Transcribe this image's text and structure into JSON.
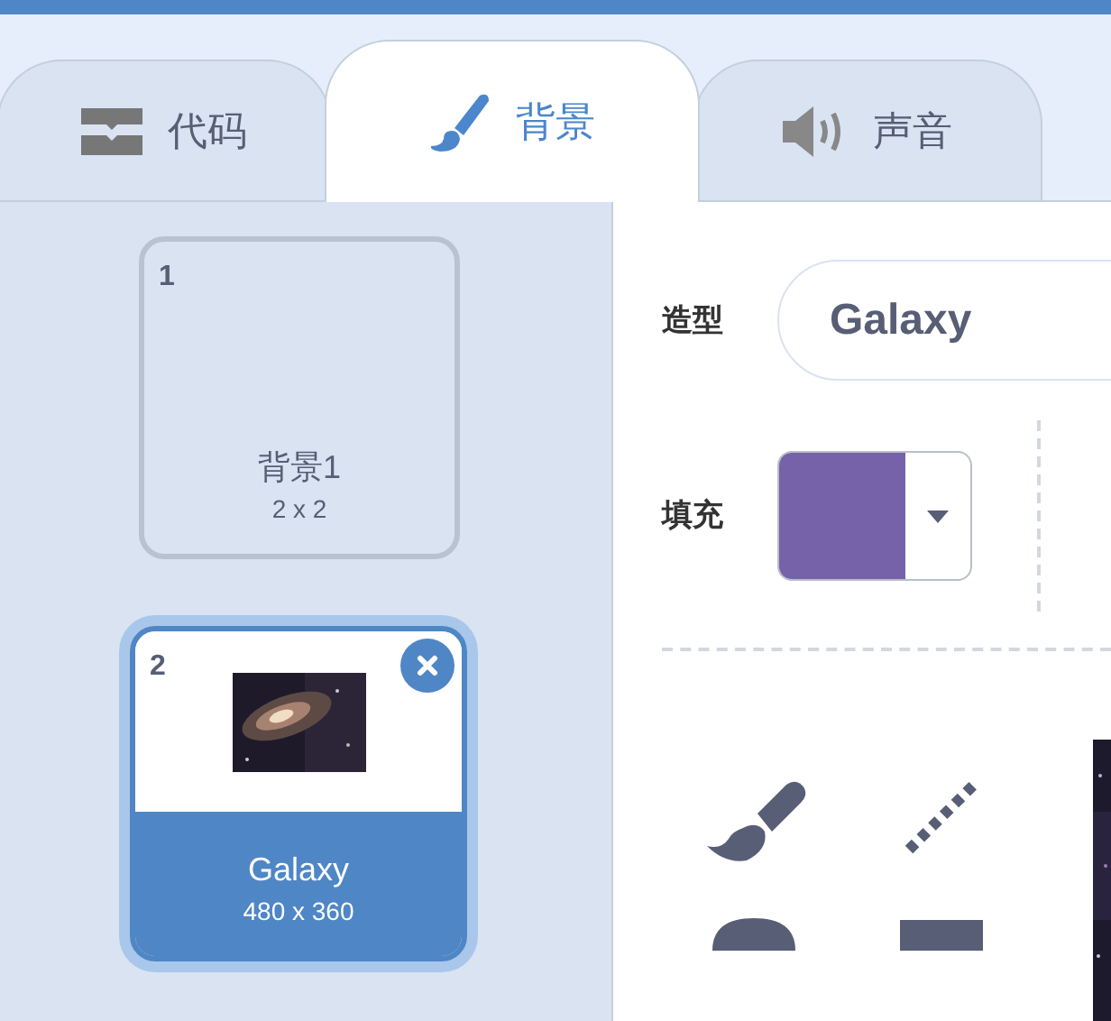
{
  "tabs": [
    {
      "label": "代码",
      "kind": "code",
      "selected": false
    },
    {
      "label": "背景",
      "kind": "backdrop",
      "selected": true
    },
    {
      "label": "声音",
      "kind": "sound",
      "selected": false
    }
  ],
  "backdrops": [
    {
      "number": "1",
      "name": "背景1",
      "size": "2 x 2",
      "selected": false
    },
    {
      "number": "2",
      "name": "Galaxy",
      "size": "480 x 360",
      "selected": true,
      "kind": "picture"
    }
  ],
  "editor": {
    "costume": {
      "label": "造型",
      "value": "Galaxy"
    },
    "fill": {
      "label": "填充",
      "color": "#7562a9"
    }
  }
}
